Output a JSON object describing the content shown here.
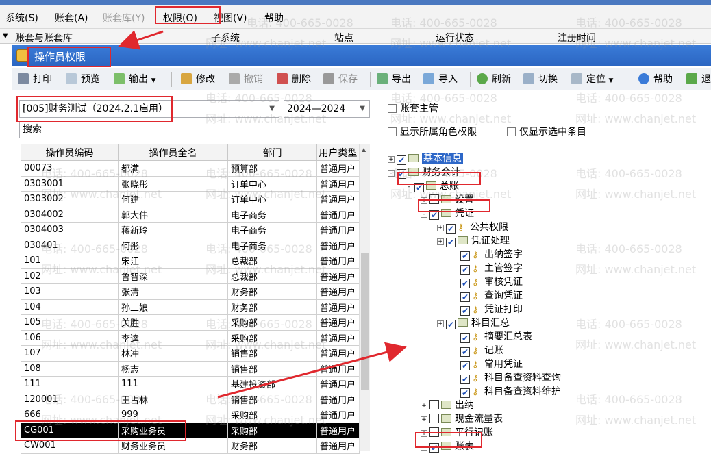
{
  "menubar": [
    "系统(S)",
    "账套(A)",
    "账套库(Y)",
    "权限(O)",
    "视图(V)",
    "帮助"
  ],
  "header_cols": [
    "账套与账套库",
    "子系统",
    "站点",
    "运行状态",
    "注册时间"
  ],
  "window_title": "操作员权限",
  "toolbar": [
    {
      "label": "打印",
      "icon": "print-icon"
    },
    {
      "label": "预览",
      "icon": "preview-icon"
    },
    {
      "label": "输出",
      "icon": "export-out-icon"
    },
    {
      "label": "修改",
      "icon": "edit-icon"
    },
    {
      "label": "撤销",
      "icon": "undo-icon"
    },
    {
      "label": "删除",
      "icon": "delete-icon"
    },
    {
      "label": "保存",
      "icon": "save-icon"
    },
    {
      "label": "导出",
      "icon": "export-icon"
    },
    {
      "label": "导入",
      "icon": "import-icon"
    },
    {
      "label": "刷新",
      "icon": "refresh-icon"
    },
    {
      "label": "切换",
      "icon": "switch-icon"
    },
    {
      "label": "定位",
      "icon": "locate-icon"
    },
    {
      "label": "帮助",
      "icon": "help-icon"
    },
    {
      "label": "退",
      "icon": "exit-icon"
    }
  ],
  "account_combo": "[005]财务测试（2024.2.1启用）",
  "year_combo": "2024—2024",
  "search_label": "搜索",
  "options": {
    "account_master": "账套主管",
    "show_role": "显示所属角色权限",
    "only_selected": "仅显示选中条目"
  },
  "grid": {
    "headers": [
      "操作员编码",
      "操作员全名",
      "部门",
      "用户类型"
    ],
    "rows": [
      [
        "00073",
        "都满",
        "预算部",
        "普通用户"
      ],
      [
        "0303001",
        "张晓彤",
        "订单中心",
        "普通用户"
      ],
      [
        "0303002",
        "何建",
        "订单中心",
        "普通用户"
      ],
      [
        "0304002",
        "郭大伟",
        "电子商务",
        "普通用户"
      ],
      [
        "0304003",
        "蒋新玲",
        "电子商务",
        "普通用户"
      ],
      [
        "030401",
        "何彤",
        "电子商务",
        "普通用户"
      ],
      [
        "101",
        "宋江",
        "总裁部",
        "普通用户"
      ],
      [
        "102",
        "鲁智深",
        "总裁部",
        "普通用户"
      ],
      [
        "103",
        "张清",
        "财务部",
        "普通用户"
      ],
      [
        "104",
        "孙二娘",
        "财务部",
        "普通用户"
      ],
      [
        "105",
        "关胜",
        "采购部",
        "普通用户"
      ],
      [
        "106",
        "李逵",
        "采购部",
        "普通用户"
      ],
      [
        "107",
        "林冲",
        "销售部",
        "普通用户"
      ],
      [
        "108",
        "杨志",
        "销售部",
        "普通用户"
      ],
      [
        "111",
        "111",
        "基建投资部",
        "普通用户"
      ],
      [
        "120001",
        "王占林",
        "销售部",
        "普通用户"
      ],
      [
        "666",
        "999",
        "采购部",
        "普通用户"
      ],
      [
        "CG001",
        "采购业务员",
        "采购部",
        "普通用户"
      ],
      [
        "CW001",
        "财务业务员",
        "财务部",
        "普通用户"
      ]
    ]
  },
  "tree": [
    {
      "label": "基本信息",
      "exp": "+",
      "checked": true,
      "icon": "folder",
      "hl": true
    },
    {
      "label": "财务会计",
      "exp": "-",
      "checked": true,
      "icon": "folder"
    },
    {
      "label": "总账",
      "exp": "-",
      "checked": true,
      "icon": "folder"
    },
    {
      "label": "设置",
      "exp": "+",
      "checked": false,
      "icon": "folder"
    },
    {
      "label": "凭证",
      "exp": "-",
      "checked": true,
      "icon": "folder"
    },
    {
      "label": "公共权限",
      "exp": "+",
      "checked": true,
      "icon": "key"
    },
    {
      "label": "凭证处理",
      "exp": "+",
      "checked": true,
      "icon": "folder"
    },
    {
      "label": "出纳签字",
      "exp": "",
      "checked": true,
      "icon": "key"
    },
    {
      "label": "主管签字",
      "exp": "",
      "checked": true,
      "icon": "key"
    },
    {
      "label": "审核凭证",
      "exp": "",
      "checked": true,
      "icon": "key"
    },
    {
      "label": "查询凭证",
      "exp": "",
      "checked": true,
      "icon": "key"
    },
    {
      "label": "凭证打印",
      "exp": "",
      "checked": true,
      "icon": "key"
    },
    {
      "label": "科目汇总",
      "exp": "+",
      "checked": true,
      "icon": "folder"
    },
    {
      "label": "摘要汇总表",
      "exp": "",
      "checked": true,
      "icon": "key"
    },
    {
      "label": "记账",
      "exp": "",
      "checked": true,
      "icon": "key"
    },
    {
      "label": "常用凭证",
      "exp": "",
      "checked": true,
      "icon": "key"
    },
    {
      "label": "科目备查资料查询",
      "exp": "",
      "checked": true,
      "icon": "key"
    },
    {
      "label": "科目备查资料维护",
      "exp": "",
      "checked": true,
      "icon": "key"
    },
    {
      "label": "出纳",
      "exp": "+",
      "checked": false,
      "icon": "folder"
    },
    {
      "label": "现金流量表",
      "exp": "+",
      "checked": false,
      "icon": "folder"
    },
    {
      "label": "平行记账",
      "exp": "+",
      "checked": false,
      "icon": "folder"
    },
    {
      "label": "账表",
      "exp": "-",
      "checked": true,
      "icon": "folder"
    }
  ],
  "watermark": {
    "phone": "电话: 400-665-0028",
    "site": "网址: www.chanjet.net"
  },
  "colors": {
    "title_bar": "#2b66c2",
    "highlight_red": "#e0282e",
    "selected_row": "#000000",
    "check_blue": "#1d4fb8"
  }
}
